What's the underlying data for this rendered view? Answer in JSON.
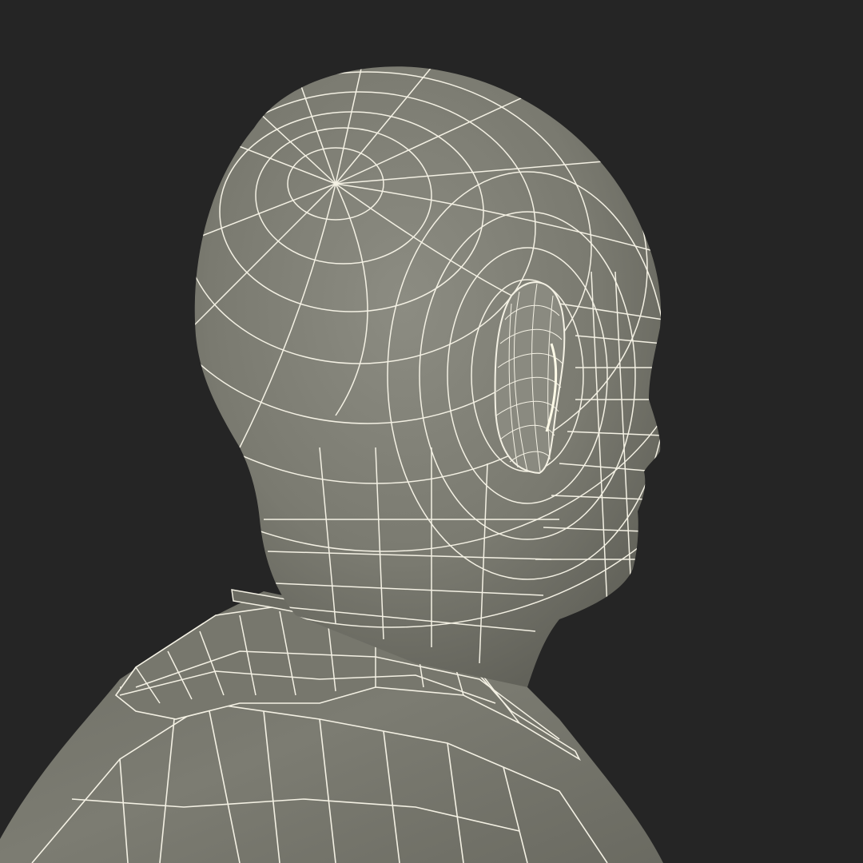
{
  "scene": {
    "subject": "wireframe-bust",
    "view": "rear-three-quarter-profile",
    "colors": {
      "background": "#252525",
      "surface_light": "#8e8e84",
      "surface_mid": "#76766c",
      "surface_dark": "#5a5a52",
      "wire": "#f4f1e4"
    }
  }
}
